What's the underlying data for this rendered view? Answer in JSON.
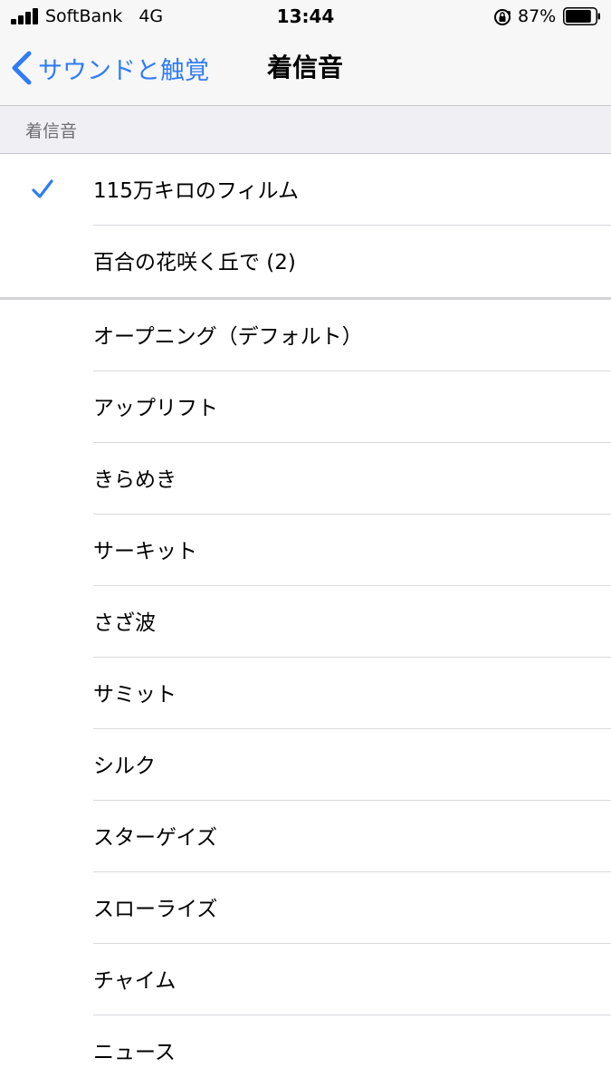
{
  "status_bar": {
    "carrier": "SoftBank",
    "network": "4G",
    "time": "13:44",
    "battery_percent": "87%",
    "battery_level": 0.87,
    "icons": [
      "signal-icon",
      "rotation-lock-icon",
      "battery-icon"
    ]
  },
  "nav": {
    "back_label": "サウンドと触覚",
    "title": "着信音",
    "accent_color": "#2f7cf6"
  },
  "section": {
    "header": "着信音"
  },
  "selected_tone": "115万キロのフィルム",
  "custom_tones": [
    {
      "label": "115万キロのフィルム",
      "selected": true
    },
    {
      "label": "百合の花咲く丘で (2)",
      "selected": false
    }
  ],
  "builtin_tones": [
    {
      "label": "オープニング（デフォルト）"
    },
    {
      "label": "アップリフト"
    },
    {
      "label": "きらめき"
    },
    {
      "label": "サーキット"
    },
    {
      "label": "さざ波"
    },
    {
      "label": "サミット"
    },
    {
      "label": "シルク"
    },
    {
      "label": "スターゲイズ"
    },
    {
      "label": "スローライズ"
    },
    {
      "label": "チャイム"
    },
    {
      "label": "ニュース"
    }
  ]
}
